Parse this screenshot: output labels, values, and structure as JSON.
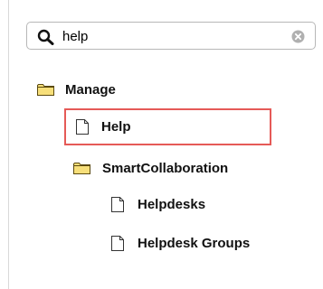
{
  "search": {
    "value": "help",
    "placeholder": ""
  },
  "tree": {
    "items": [
      {
        "label": "Manage",
        "type": "folder",
        "level": 0
      },
      {
        "label": "Help",
        "type": "document",
        "level": 1,
        "highlighted": true
      },
      {
        "label": "SmartCollaboration",
        "type": "folder",
        "level": 1
      },
      {
        "label": "Helpdesks",
        "type": "document",
        "level": 2
      },
      {
        "label": "Helpdesk Groups",
        "type": "document",
        "level": 2
      }
    ]
  },
  "colors": {
    "folder_fill": "#f7df7a",
    "folder_stroke": "#5b4a10",
    "document_fill": "#ffffff",
    "document_stroke": "#333333",
    "highlight_border": "#e55a57",
    "search_border": "#b7b7b7",
    "clear_icon": "#b0b0b0"
  },
  "icons": {
    "search": "magnifier-icon",
    "clear": "clear-circle-icon",
    "folder": "folder-icon",
    "document": "document-icon"
  }
}
